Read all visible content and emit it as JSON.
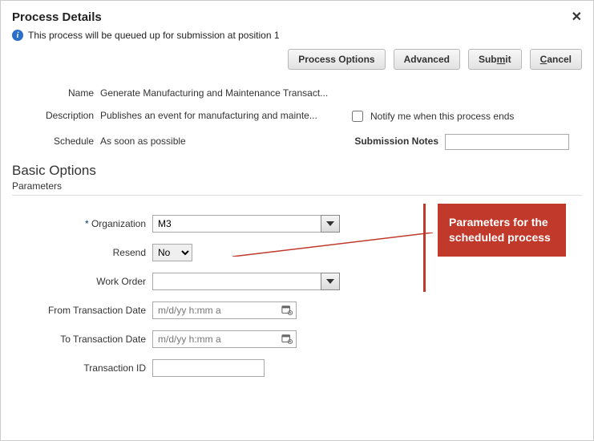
{
  "header": {
    "title": "Process Details"
  },
  "info": {
    "message": "This process will be queued up for submission at position 1"
  },
  "actions": {
    "process_options": "Process Options",
    "advanced": "Advanced",
    "submit": "Submit",
    "cancel": "Cancel"
  },
  "meta": {
    "name_label": "Name",
    "name_value": "Generate Manufacturing and Maintenance Transact...",
    "description_label": "Description",
    "description_value": "Publishes an event for manufacturing and mainte...",
    "notify_label": "Notify me when this process ends",
    "schedule_label": "Schedule",
    "schedule_value": "As soon as possible",
    "submission_notes_label": "Submission Notes",
    "submission_notes_value": ""
  },
  "section": {
    "title": "Basic Options",
    "subtitle": "Parameters"
  },
  "params": {
    "organization": {
      "label": "Organization",
      "value": "M3"
    },
    "resend": {
      "label": "Resend",
      "value": "No"
    },
    "work_order": {
      "label": "Work Order",
      "value": ""
    },
    "from_date": {
      "label": "From Transaction Date",
      "placeholder": "m/d/yy h:mm a",
      "value": ""
    },
    "to_date": {
      "label": "To Transaction Date",
      "placeholder": "m/d/yy h:mm a",
      "value": ""
    },
    "transaction_id": {
      "label": "Transaction ID",
      "value": ""
    }
  },
  "callout": {
    "text": "Parameters for the scheduled process"
  }
}
